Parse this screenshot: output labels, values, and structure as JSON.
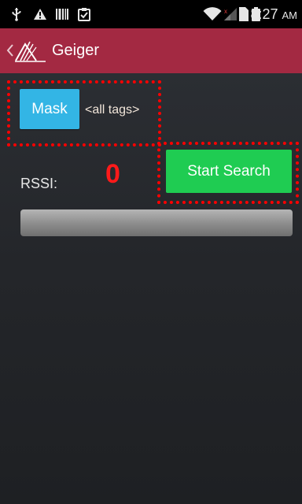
{
  "status_bar": {
    "time": "8:27",
    "ampm": "AM",
    "icons": [
      "usb-icon",
      "warning-icon",
      "barcode-icon",
      "clipboard-icon",
      "wifi-icon",
      "signal-icon",
      "sim-icon",
      "battery-icon"
    ]
  },
  "action_bar": {
    "title": "Geiger",
    "color": "#a32942"
  },
  "mask": {
    "button_label": "Mask",
    "tags_label": "<all tags>",
    "button_color": "#33b5e5"
  },
  "rssi": {
    "label": "RSSI:",
    "value": "0",
    "value_color": "#ff1a1a"
  },
  "search": {
    "button_label": "Start Search",
    "button_color": "#1fcc52"
  },
  "progress": {
    "value": 0
  }
}
